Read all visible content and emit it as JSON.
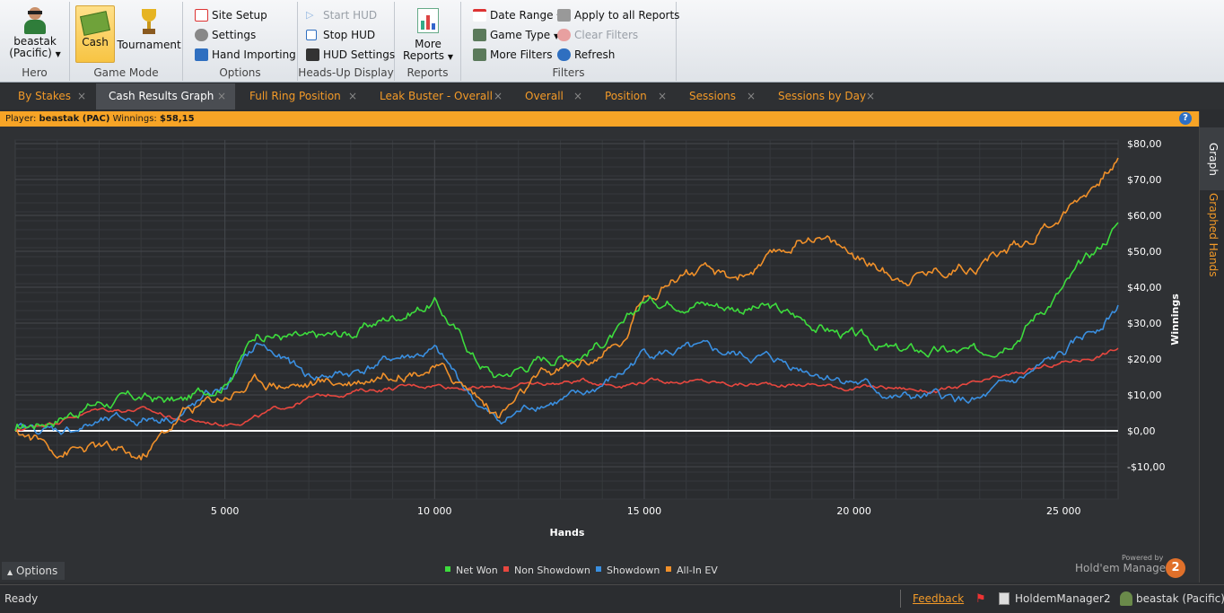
{
  "ribbon": {
    "hero": {
      "name": "beastak",
      "site": "(Pacific)",
      "group_label": "Hero"
    },
    "game_mode": {
      "cash": "Cash",
      "tournament": "Tournament",
      "group_label": "Game Mode"
    },
    "options": {
      "site_setup": "Site Setup",
      "settings": "Settings",
      "hand_importing": "Hand Importing",
      "group_label": "Options"
    },
    "hud": {
      "start": "Start HUD",
      "stop": "Stop HUD",
      "settings": "HUD Settings",
      "group_label": "Heads-Up Display"
    },
    "reports": {
      "more_line1": "More",
      "more_line2": "Reports",
      "group_label": "Reports"
    },
    "filters": {
      "date_range": "Date Range",
      "game_type": "Game Type",
      "more_filters": "More Filters",
      "apply_all": "Apply to all Reports",
      "clear": "Clear Filters",
      "refresh": "Refresh",
      "group_label": "Filters"
    }
  },
  "tabs": [
    {
      "label": "By Stakes",
      "close": "×"
    },
    {
      "label": "Cash Results Graph",
      "close": "×"
    },
    {
      "label": "Full Ring Position",
      "close": "×"
    },
    {
      "label": "Leak Buster - Overall",
      "close": "×"
    },
    {
      "label": "Overall",
      "close": "×"
    },
    {
      "label": "Position",
      "close": "×"
    },
    {
      "label": "Sessions",
      "close": "×"
    },
    {
      "label": "Sessions by Day",
      "close": "×"
    }
  ],
  "player_bar": {
    "player_label": "Player:",
    "player": "beastak (PAC)",
    "winnings_label": "Winnings:",
    "winnings": "$58,15",
    "help": "?"
  },
  "side_tabs": {
    "graph": "Graph",
    "graphed_hands": "Graphed Hands"
  },
  "options_button": "Options",
  "branding": {
    "powered": "Powered by",
    "product": "Hold'em Manager",
    "badge": "2"
  },
  "status": {
    "ready": "Ready",
    "feedback": "Feedback",
    "app": "HoldemManager2",
    "user": "beastak (Pacific)"
  },
  "colors": {
    "net_won": "#3ddc3d",
    "non_showdown": "#e8473f",
    "showdown": "#3a8fe0",
    "all_in_ev": "#f0902a",
    "accent": "#f39a28"
  },
  "chart_data": {
    "type": "line",
    "xlabel": "Hands",
    "ylabel": "Winnings",
    "xlim": [
      0,
      26300
    ],
    "ylim": [
      -19,
      81
    ],
    "x_ticks": [
      5000,
      10000,
      15000,
      20000,
      25000
    ],
    "x_tick_labels": [
      "5 000",
      "10 000",
      "15 000",
      "20 000",
      "25 000"
    ],
    "y_ticks": [
      -10,
      0,
      10,
      20,
      30,
      40,
      50,
      60,
      70,
      80
    ],
    "y_tick_labels": [
      "-$10,00",
      "$0,00",
      "$10,00",
      "$20,00",
      "$30,00",
      "$40,00",
      "$50,00",
      "$60,00",
      "$70,00",
      "$80,00"
    ],
    "grid": true,
    "legend_position": "bottom",
    "x": [
      0,
      1000,
      2000,
      3000,
      4000,
      5000,
      5800,
      7000,
      8000,
      9000,
      10000,
      11000,
      11500,
      12500,
      13500,
      14500,
      15000,
      16000,
      17000,
      18000,
      19000,
      20000,
      21000,
      22000,
      23000,
      24000,
      25000,
      25800,
      26300
    ],
    "series": [
      {
        "name": "Net Won",
        "color": "#3ddc3d",
        "values": [
          0,
          4,
          8,
          9,
          8,
          14,
          28,
          25,
          27,
          32,
          36,
          20,
          15,
          20,
          22,
          28,
          36,
          37,
          35,
          34,
          30,
          26,
          22,
          22,
          21,
          29,
          40,
          50,
          58
        ]
      },
      {
        "name": "Non Showdown",
        "color": "#e8473f",
        "values": [
          0,
          3,
          6,
          6,
          3,
          2,
          4,
          9,
          11,
          12,
          13,
          12,
          12,
          13,
          14,
          13,
          14,
          14,
          13,
          13,
          13,
          12,
          12,
          11,
          13,
          16,
          19,
          21,
          23
        ]
      },
      {
        "name": "Showdown",
        "color": "#3a8fe0",
        "values": [
          0,
          0,
          2,
          3,
          5,
          12,
          24,
          15,
          16,
          20,
          22,
          8,
          2,
          8,
          9,
          16,
          22,
          22,
          21,
          20,
          17,
          14,
          9,
          9,
          8,
          14,
          21,
          29,
          35
        ]
      },
      {
        "name": "All-In EV",
        "color": "#f0902a",
        "values": [
          0,
          -5,
          -5,
          -8,
          5,
          10,
          14,
          13,
          14,
          17,
          18,
          10,
          4,
          14,
          19,
          24,
          38,
          45,
          42,
          47,
          55,
          49,
          43,
          45,
          47,
          52,
          61,
          70,
          76
        ]
      }
    ]
  }
}
